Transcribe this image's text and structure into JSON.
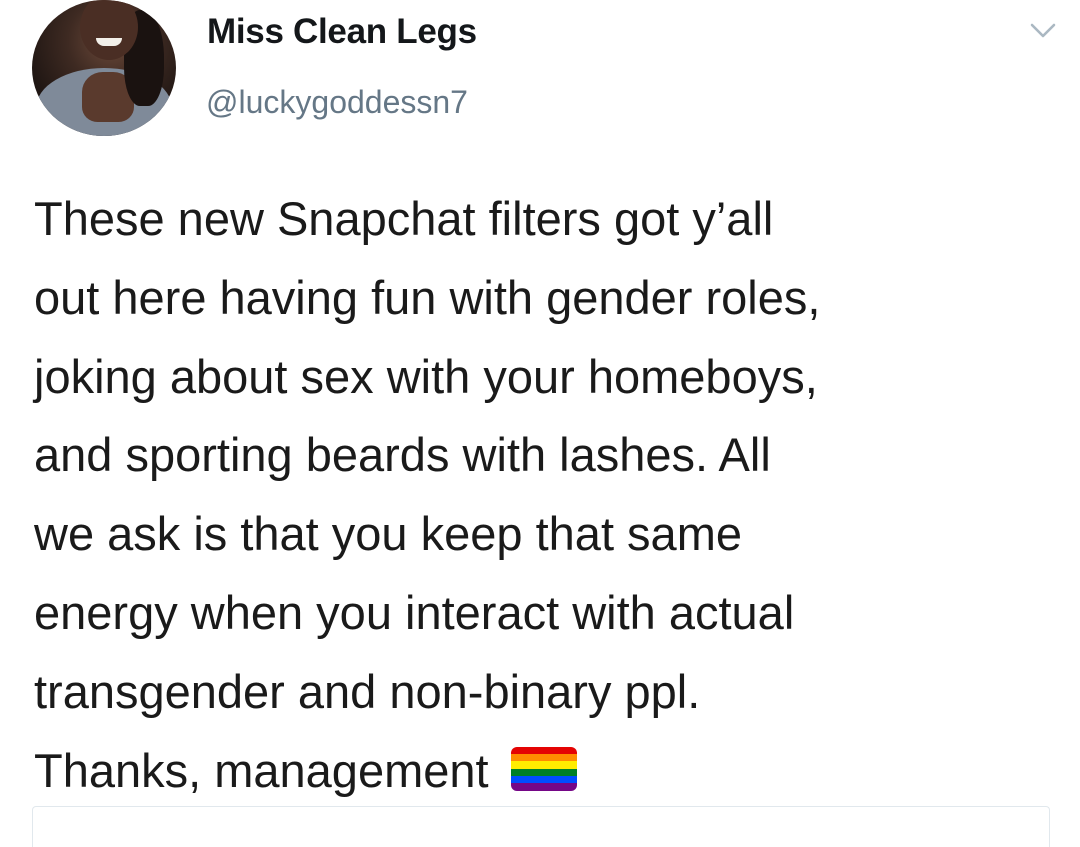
{
  "tweet": {
    "display_name": "Miss Clean Legs",
    "handle": "@luckygoddessn7",
    "text_lines": [
      "These new Snapchat filters got y’all",
      "out here having fun with gender roles,",
      "joking about sex with your homeboys,",
      "and sporting beards with lashes. All",
      "we ask is that you keep that same",
      "energy when you interact with actual",
      "transgender and non-binary ppl.",
      "Thanks, management"
    ],
    "emoji": "rainbow-flag-icon"
  },
  "colors": {
    "name": "#14171a",
    "handle": "#657786",
    "text": "#1a1a1a",
    "chevron": "#aab8c2",
    "rainbow": [
      "#e40303",
      "#ff8c00",
      "#ffed00",
      "#008026",
      "#004dff",
      "#750787"
    ]
  },
  "icons": {
    "menu": "chevron-down-icon"
  }
}
